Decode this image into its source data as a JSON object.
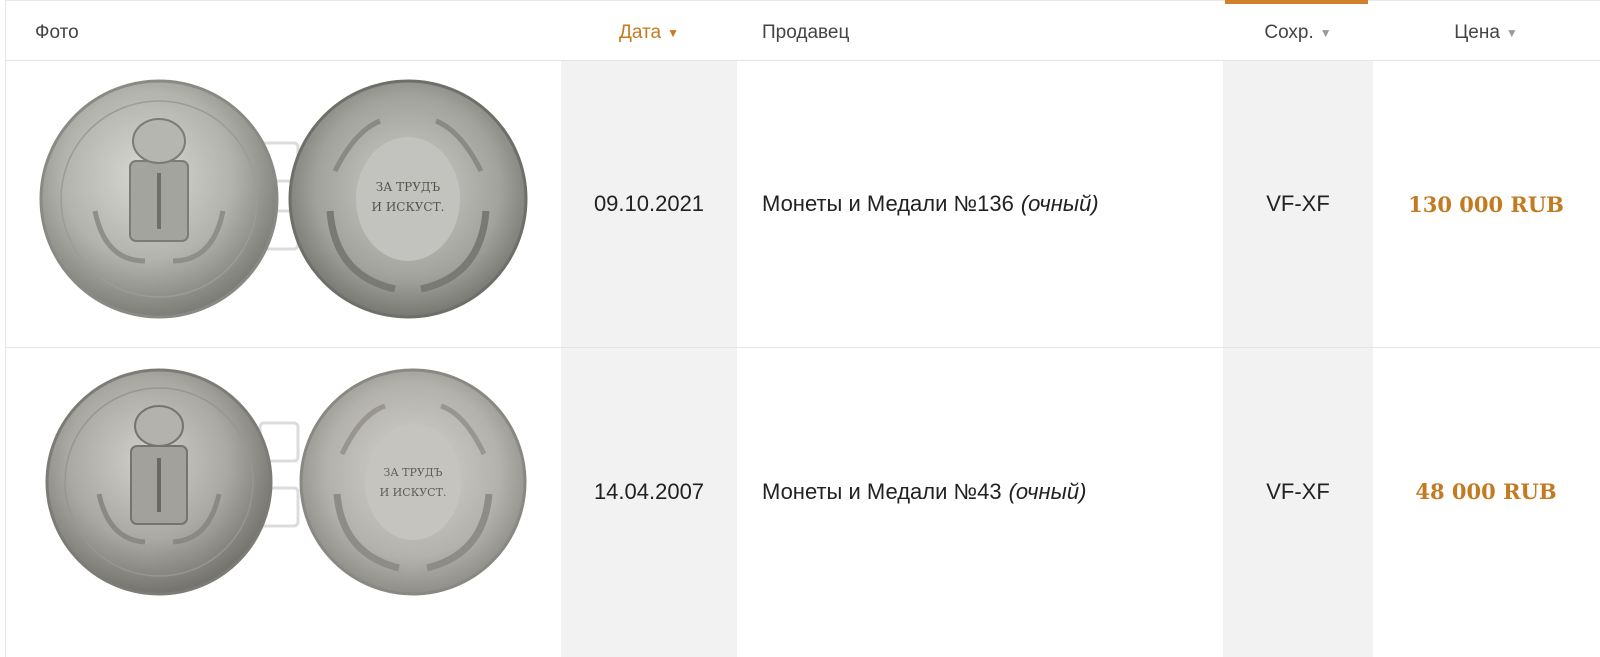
{
  "header": {
    "photo": "Фото",
    "date": "Дата",
    "seller": "Продавец",
    "condition": "Сохр.",
    "price": "Цена",
    "caret": "▼"
  },
  "rows": [
    {
      "date": "09.10.2021",
      "seller": "Монеты и Медали №136",
      "seller_mode": "(очный)",
      "condition": "VF-XF",
      "price": "130 000 RUB",
      "reverse_text": "ЗА ТРУДЪ И ИСКУСТ."
    },
    {
      "date": "14.04.2007",
      "seller": "Монеты и Медали №43",
      "seller_mode": "(очный)",
      "condition": "VF-XF",
      "price": "48 000 RUB",
      "reverse_text": "ЗА ТРУДЪ И ИСКУСТ."
    }
  ],
  "colors": {
    "accent": "#c37a20",
    "shade": "#f2f2f2",
    "silver": "#b9b9b6"
  }
}
